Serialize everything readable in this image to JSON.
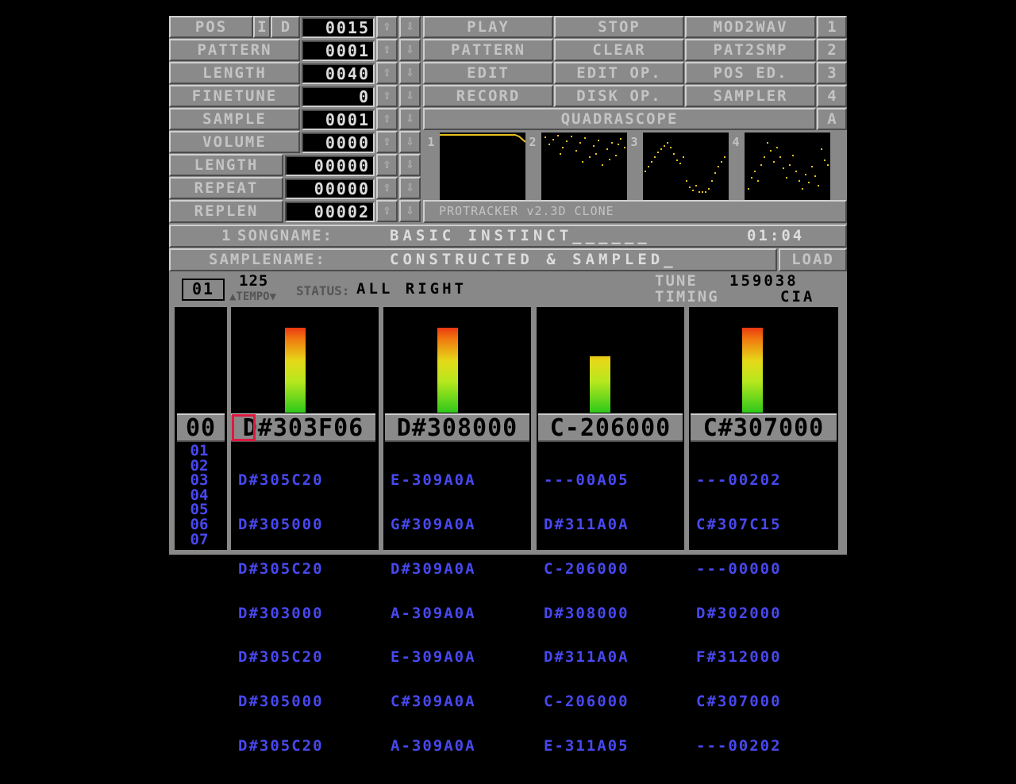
{
  "controls": {
    "rows": [
      {
        "label": "POS",
        "value": "0015"
      },
      {
        "label": "PATTERN",
        "value": "0001"
      },
      {
        "label": "LENGTH",
        "value": "0040"
      },
      {
        "label": "FINETUNE",
        "value": "0"
      },
      {
        "label": "SAMPLE",
        "value": "0001"
      },
      {
        "label": "VOLUME",
        "value": "0000"
      },
      {
        "label": "LENGTH",
        "value": "00000"
      },
      {
        "label": "REPEAT",
        "value": "00000"
      },
      {
        "label": "REPLEN",
        "value": "00002"
      }
    ],
    "pos_buttons": [
      "I",
      "D"
    ],
    "up_arrow": "⇧",
    "down_arrow": "⇩"
  },
  "menu": {
    "row1": [
      "PLAY",
      "STOP",
      "MOD2WAV",
      "1"
    ],
    "row2": [
      "PATTERN",
      "CLEAR",
      "PAT2SMP",
      "2"
    ],
    "row3": [
      "EDIT",
      "EDIT OP.",
      "POS ED.",
      "3"
    ],
    "row4": [
      "RECORD",
      "DISK OP.",
      "SAMPLER",
      "4"
    ],
    "quadrascope": "QUADRASCOPE",
    "quadrascope_key": "A"
  },
  "scopes": {
    "channels": [
      "1",
      "2",
      "3",
      "4"
    ],
    "color": "#e8c020",
    "footer": "PROTRACKER v2.3D CLONE"
  },
  "song": {
    "number": "1",
    "label": "SONGNAME:",
    "name": "BASIC INSTINCT______",
    "time": "01:04",
    "sample_label": "SAMPLENAME:",
    "sample_name": "CONSTRUCTED & SAMPLED_",
    "load": "LOAD"
  },
  "status": {
    "octave": "01",
    "tempo_value": "125",
    "tempo_label": "▲TEMPO▼",
    "status_label": "STATUS:",
    "status_value": "ALL RIGHT",
    "tune_label": "TUNE",
    "tune_value": "159038",
    "timing_label": "TIMING",
    "timing_value": "CIA"
  },
  "pattern": {
    "current_row": "00",
    "row_numbers": [
      "01",
      "02",
      "03",
      "04",
      "05",
      "06",
      "07"
    ],
    "channels": [
      {
        "vu": 0.95,
        "current": "D#303F06",
        "rows": [
          "D#305C20",
          "D#305000",
          "D#305C20",
          "D#303000",
          "D#305C20",
          "D#305000",
          "D#305C20"
        ]
      },
      {
        "vu": 0.95,
        "current": "D#308000",
        "rows": [
          "E-309A0A",
          "G#309A0A",
          "D#309A0A",
          "A-309A0A",
          "E-309A0A",
          "C#309A0A",
          "A-309A0A"
        ]
      },
      {
        "vu": 0.63,
        "current": "C-206000",
        "rows": [
          "---00A05",
          "D#311A0A",
          "C-206000",
          "D#308000",
          "D#311A0A",
          "C-206000",
          "E-311A05"
        ]
      },
      {
        "vu": 0.95,
        "current": "C#307000",
        "rows": [
          "---00202",
          "C#307C15",
          "---00000",
          "D#302000",
          "F#312000",
          "C#307000",
          "---00202"
        ]
      }
    ],
    "vu_colors": [
      "#e81c12",
      "#f07a10",
      "#e6d818",
      "#2ec81a"
    ],
    "highlight_color": "#e01840",
    "row_color": "#4848f0"
  }
}
